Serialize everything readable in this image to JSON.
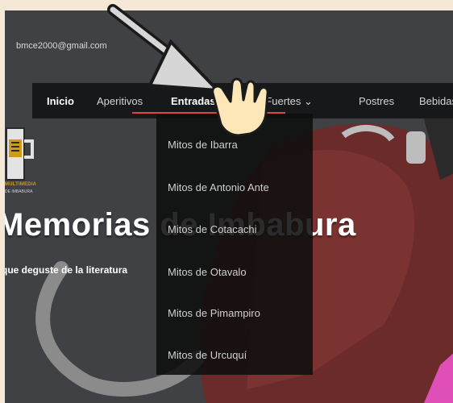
{
  "header": {
    "email": "bmce2000@gmail.com"
  },
  "nav": {
    "items": [
      {
        "label": "Inicio"
      },
      {
        "label": "Aperitivos"
      },
      {
        "label": "Entradas"
      },
      {
        "label": "os Fuertes ⌄"
      },
      {
        "label": "Postres"
      },
      {
        "label": "Bebidas"
      }
    ],
    "active": "Entradas"
  },
  "dropdown": {
    "items": [
      {
        "label": "Mitos de Ibarra"
      },
      {
        "label": "Mitos de Antonio Ante"
      },
      {
        "label": "Mitos de Cotacachi"
      },
      {
        "label": "Mitos de Otavalo"
      },
      {
        "label": "Mitos de Pimampiro"
      },
      {
        "label": "Mitos de Urcuquí"
      }
    ]
  },
  "logo": {
    "text": "MULTIMEDIA",
    "subtext": "DE IMBABURA"
  },
  "hero": {
    "title": "Memorias de Imbabura",
    "subtitle": "que deguste de la literatura"
  },
  "icons": {
    "cursor": "hand-pointer-icon",
    "annotation": "arrow-icon",
    "dropdown_caret": "chevron-down-icon"
  },
  "colors": {
    "nav_bg": "#17181a",
    "accent_underline": "#e04545",
    "logo_gold": "#d19a1b",
    "background_frame": "#f6e8d6"
  }
}
